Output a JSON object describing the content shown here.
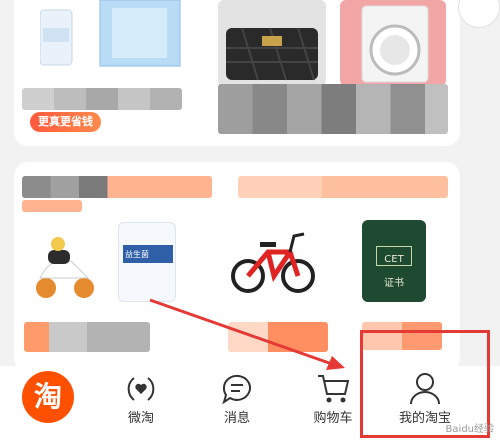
{
  "promo": {
    "label": "更真更省钱"
  },
  "tabs": [
    {
      "label": "",
      "icon": "taobao-logo-icon"
    },
    {
      "label": "微淘",
      "icon": "broadcast-heart-icon"
    },
    {
      "label": "消息",
      "icon": "chat-bubble-icon"
    },
    {
      "label": "购物车",
      "icon": "cart-icon"
    },
    {
      "label": "我的淘宝",
      "icon": "user-icon"
    }
  ],
  "logo": {
    "char": "淘"
  },
  "products": [
    {
      "name": "diaper-pack"
    },
    {
      "name": "handbag"
    },
    {
      "name": "washing-machine"
    },
    {
      "name": "toy-motorcycle"
    },
    {
      "name": "supplement-bottle"
    },
    {
      "name": "kids-bicycle"
    },
    {
      "name": "cet-certificate"
    }
  ],
  "certificate": {
    "line1": "CET",
    "line2": "证书"
  },
  "supplement": {
    "brand": "益生菌"
  },
  "highlight_color": "#e53935",
  "accent_color": "#ff5000",
  "watermark": "Baidu经验"
}
